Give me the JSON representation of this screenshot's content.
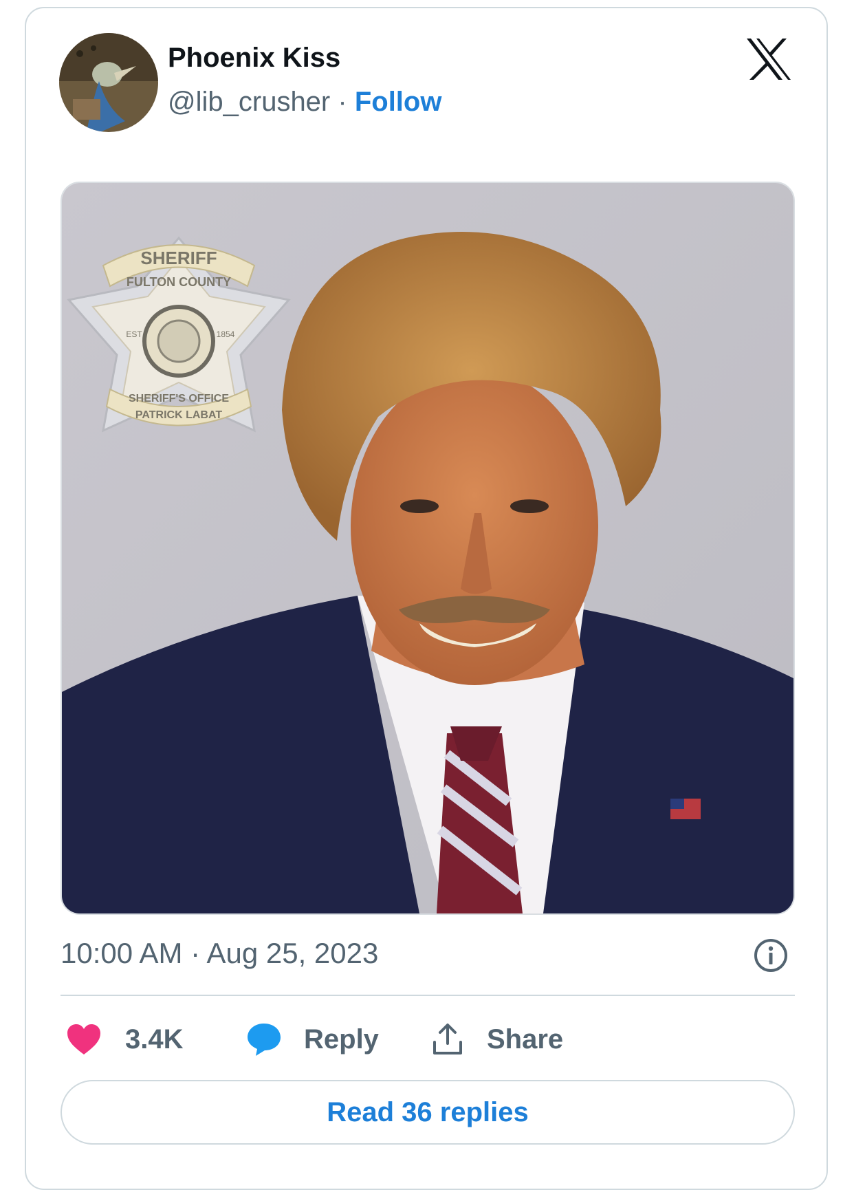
{
  "post": {
    "author": {
      "name": "Phoenix Kiss",
      "handle": "@lib_crusher",
      "separator": "·",
      "follow_label": "Follow"
    },
    "platform_icon": "x-logo-icon",
    "media": {
      "badge_top": "SHERIFF",
      "badge_arc": "FULTON COUNTY",
      "badge_est": "EST",
      "badge_year": "1854",
      "badge_bottom": "SHERIFF'S OFFICE",
      "badge_name": "PATRICK LABAT"
    },
    "timestamp": "10:00 AM · Aug 25, 2023",
    "info_icon": "info-icon",
    "actions": {
      "like_count": "3.4K",
      "reply_label": "Reply",
      "share_label": "Share"
    },
    "read_replies_label": "Read 36 replies"
  },
  "colors": {
    "accent_blue": "#1d7fd8",
    "like_pink": "#f0327e",
    "reply_blue": "#1d9bf0",
    "muted_text": "#536471",
    "border": "#cfd9de"
  }
}
